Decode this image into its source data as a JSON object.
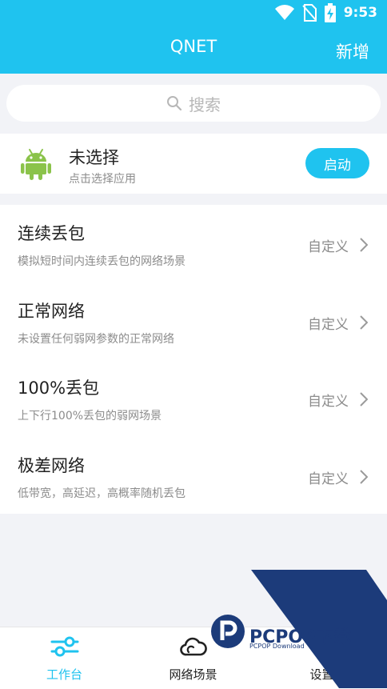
{
  "status_bar": {
    "time": "9:53",
    "icons": [
      "wifi-icon",
      "no-sim-icon",
      "battery-charging-icon"
    ]
  },
  "header": {
    "title": "QNET",
    "add_label": "新增"
  },
  "search": {
    "placeholder": "搜索",
    "icon": "search-icon"
  },
  "selected_app": {
    "title": "未选择",
    "subtitle": "点击选择应用",
    "start_label": "启动",
    "icon": "android-icon"
  },
  "scenes": [
    {
      "title": "连续丢包",
      "desc": "模拟短时间内连续丢包的网络场景",
      "action": "自定义"
    },
    {
      "title": "正常网络",
      "desc": "未设置任何弱网参数的正常网络",
      "action": "自定义"
    },
    {
      "title": "100%丢包",
      "desc": "上下行100%丢包的弱网场景",
      "action": "自定义"
    },
    {
      "title": "极差网络",
      "desc": "低带宽，高延迟，高概率随机丢包",
      "action": "自定义"
    }
  ],
  "tabs": [
    {
      "label": "工作台",
      "icon": "sliders-icon",
      "active": true
    },
    {
      "label": "网络场景",
      "icon": "cloud-icon",
      "active": false
    },
    {
      "label": "设置",
      "icon": "gear-icon",
      "active": false
    }
  ],
  "watermark": {
    "text": "PCPOP下载",
    "sub": "PCPOP Download"
  },
  "colors": {
    "accent": "#1fc3ef",
    "android_green": "#8bc34a",
    "watermark_blue": "#1c3b7a"
  }
}
